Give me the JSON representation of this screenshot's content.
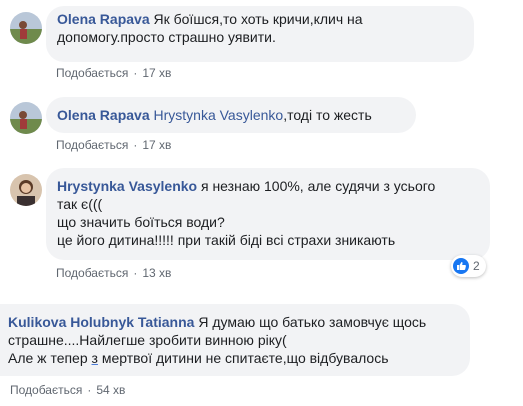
{
  "comments": [
    {
      "author": "Olena Rapava",
      "text": "Як боїшся,то хоть кричи,клич на допомогу.просто страшно уявити.",
      "like_label": "Подобається",
      "separator": "·",
      "time": "17 хв"
    },
    {
      "author": "Olena Rapava",
      "mention": "Hrystynka Vasylenko",
      "text": ",тоді то жесть",
      "like_label": "Подобається",
      "separator": "·",
      "time": "17 хв"
    },
    {
      "author": "Hrystynka Vasylenko",
      "text_lines": [
        "я незнаю 100%, але судячи з усього",
        "так є(((",
        "що значить боїться води?",
        "це його дитина!!!!! при такій біді всі страхи зникають"
      ],
      "like_label": "Подобається",
      "separator": "·",
      "time": "13 хв",
      "reaction_count": "2"
    },
    {
      "author": "Kulikova Holubnyk Tatianna",
      "text_lines": [
        "Я думаю що батько замовчує щось",
        "страшне....Найлегше зробити винною ріку(",
        "Але ж тепер ",
        "з",
        " мертвої дитини не спитаєте,що відбувалось"
      ],
      "like_label": "Подобається",
      "separator": "·",
      "time": "54 хв"
    }
  ],
  "colors": {
    "bubble_bg": "#f2f3f5",
    "author": "#385898",
    "meta": "#606770",
    "like_badge": "#1877f2"
  }
}
